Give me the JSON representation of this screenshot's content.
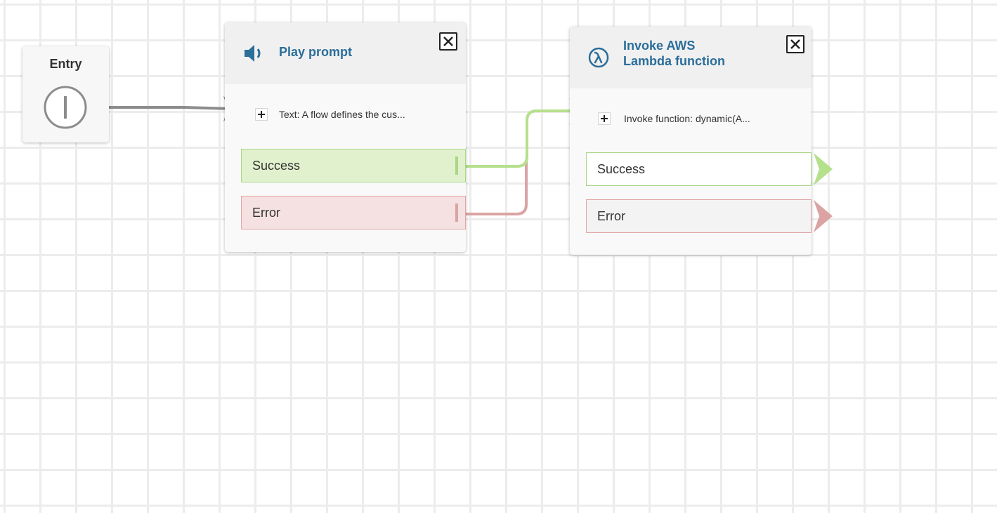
{
  "entry": {
    "title": "Entry"
  },
  "blocks": [
    {
      "id": "play-prompt",
      "title": "Play prompt",
      "icon": "speaker-icon",
      "parameter": "Text: A flow defines the cus...",
      "branches": [
        {
          "label": "Success",
          "status": "success",
          "connected": true
        },
        {
          "label": "Error",
          "status": "error",
          "connected": true
        }
      ]
    },
    {
      "id": "invoke-lambda",
      "title_line1": "Invoke AWS",
      "title_line2": "Lambda function",
      "icon": "lambda-icon",
      "parameter": "Invoke function: dynamic(A...",
      "branches": [
        {
          "label": "Success",
          "status": "success",
          "connected": false
        },
        {
          "label": "Error",
          "status": "error",
          "connected": false
        }
      ]
    }
  ],
  "colors": {
    "title": "#2a6e9a",
    "entry_connector": "#8c8c8c",
    "success_connector": "#b5e08c",
    "error_connector": "#dba3a3",
    "success_fill": "#e1f1cd",
    "error_fill": "#f5e1e1"
  }
}
